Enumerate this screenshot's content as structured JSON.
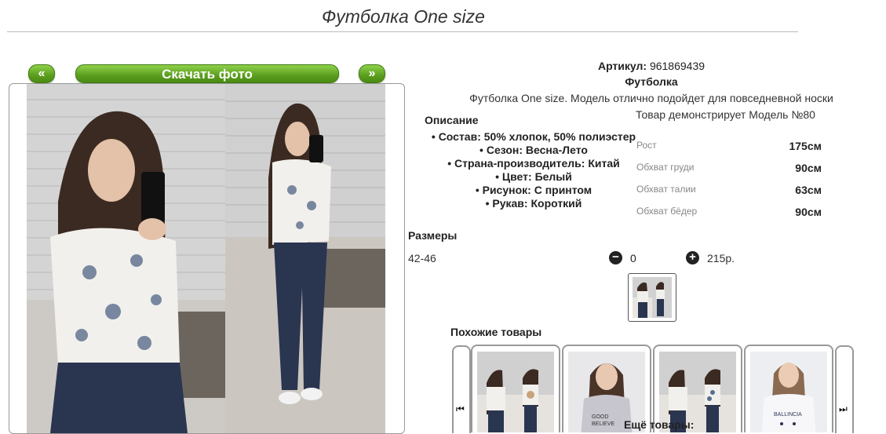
{
  "page": {
    "title": "Футболка One size"
  },
  "gallery": {
    "prev_label": "«",
    "next_label": "»",
    "download_label": "Скачать фото"
  },
  "product": {
    "article_label": "Артикул:",
    "article_value": "961869439",
    "type": "Футболка",
    "description": "Футболка One size. Модель отлично подойдет для повседневной носки",
    "model_note": "Товар демонстрирует Модель №80"
  },
  "description": {
    "heading": "Описание",
    "items": [
      "Состав: 50% хлопок, 50% полиэстер",
      "Сезон: Весна-Лето",
      "Страна-производитель: Китай",
      "Цвет: Белый",
      "Рисунок: С принтом",
      "Рукав: Короткий"
    ]
  },
  "model_params": [
    {
      "label": "Рост",
      "value": "175см"
    },
    {
      "label": "Обхват груди",
      "value": "90см"
    },
    {
      "label": "Обхват талии",
      "value": "63см"
    },
    {
      "label": "Обхват бёдер",
      "value": "90см"
    }
  ],
  "sizes": {
    "heading": "Размеры",
    "size": "42-46",
    "minus": "−",
    "plus": "+",
    "quantity": "0",
    "price": "215р."
  },
  "similar": {
    "heading": "Похожие товары",
    "prev_arrow": "⏮",
    "next_arrow": "⏭",
    "more_label": "Ещё товары:"
  },
  "colors": {
    "accent_green": "#5b9e1d",
    "brick_wall": "#cfcfcf",
    "jeans": "#2a3550",
    "shirt": "#f2f0ec"
  }
}
